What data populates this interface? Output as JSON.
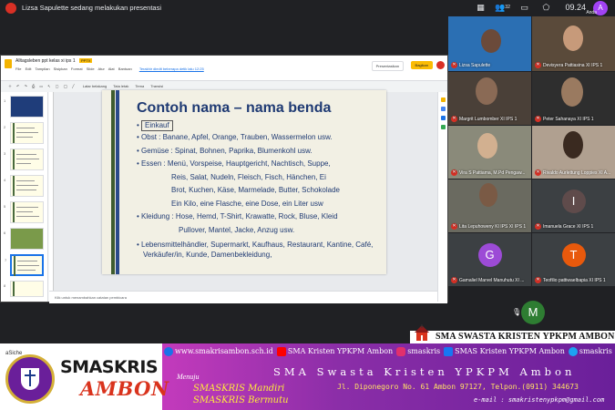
{
  "meet": {
    "presenting_text": "Lizsa Sapulette sedang melakukan presentasi",
    "clock": "09.24",
    "self_initial": "A",
    "self_label": "Anda",
    "participant_count": "32"
  },
  "slides_app": {
    "file_title": "Alltagsleben ppt kelas xi ips 1",
    "file_tag": "PPTX",
    "menu": [
      "File",
      "Edit",
      "Tampilan",
      "Sisipkan",
      "Format",
      "Slide",
      "Atur",
      "Alat",
      "Bantuan"
    ],
    "last_edit": "Terakhir diedit beberapa detik lalu 12:25",
    "present_label": "Presentasikan",
    "share_label": "Bagikan",
    "toolbar": [
      "Latar belakang",
      "Tata letak",
      "Tema",
      "Transisi"
    ],
    "notes_placeholder": "Klik untuk menambahkan catatan pembicara",
    "thumb_numbers": [
      "1",
      "2",
      "3",
      "4",
      "5",
      "6",
      "7",
      "8",
      "9"
    ]
  },
  "slide": {
    "title": "Contoh nama – nama benda",
    "einkauf": "Einkauf",
    "lines": [
      "Obst : Banane, Apfel, Orange, Trauben, Wassermelon usw.",
      "Gemüse : Spinat, Bohnen, Paprika, Blumenkohl usw.",
      "Essen : Menü, Vorspeise, Hauptgericht, Nachtisch, Suppe,",
      "Reis, Salat, Nudeln, Fleisch, Fisch, Hänchen, Ei",
      "Brot, Kuchen, Käse, Marmelade, Butter, Schokolade",
      "Ein Kilo, eine Flasche, eine Dose, ein Liter usw",
      "Kleidung : Hose, Hemd, T-Shirt, Krawatte, Rock, Bluse, Kleid",
      "Pullover, Mantel, Jacke, Anzug usw.",
      "Lebensmittelhändler, Supermarkt, Kaufhaus, Restaurant, Kantine, Café,",
      "Verkäufer/in, Kunde, Damenbekleidung,"
    ]
  },
  "participants": [
    {
      "name": "Lizsa Sapulette",
      "initial": ""
    },
    {
      "name": "Devisyera Pattiasina XI IPS 1",
      "initial": ""
    },
    {
      "name": "Margrit Lumbomber XI IPS 1",
      "initial": ""
    },
    {
      "name": "Peter Sahanaya XI IPS 1",
      "initial": ""
    },
    {
      "name": "Vira S Pattiama, M.Pd Pengaw...",
      "initial": ""
    },
    {
      "name": "Rivaldo Aurlettung Loppies XI A...",
      "initial": ""
    },
    {
      "name": "Lita Lepuhoweny KI IPS XI IPS 1",
      "initial": ""
    },
    {
      "name": "Imanuela Grace XI IPS 1",
      "initial": "I"
    },
    {
      "name": "Gamaliel Marvel Manuhutu XI ...",
      "initial": "G"
    },
    {
      "name": "Teofilio pattiwaelbapia XI IPS 1",
      "initial": "T"
    }
  ],
  "bottom_participant_initial": "M",
  "colors": {
    "avatar_I": "#5f4b4b",
    "avatar_G": "#9c4bd6",
    "avatar_T": "#e8590c",
    "avatar_M": "#2e7d32",
    "banner_purple": "#b52fae",
    "brand_red": "#d9331d"
  },
  "banner": {
    "top_text": "SMA SWASTA KRISTEN YPKPM AMBON",
    "asiche": "aSiche",
    "brand_line1": "SMASKRIS",
    "brand_line2": "AMBON",
    "website": "www.smakrisambon.sch.id",
    "youtube": "SMA Kristen YPKPM Ambon",
    "instagram": "smaskris",
    "facebook": "SMAS Kristen YPKPM Ambon",
    "twitter": "smaskris",
    "school_name": "SMA Swasta Kristen YPKPM Ambon",
    "menuju": "Menuju",
    "mandiri": "SMASKRIS Mandiri",
    "bermutu": "SMASKRIS Bermutu",
    "address": "Jl. Diponegoro No. 61 Ambon 97127, Telpon.(0911) 344673",
    "email": "e-mail : smakristenypkpm@gmail.com"
  }
}
